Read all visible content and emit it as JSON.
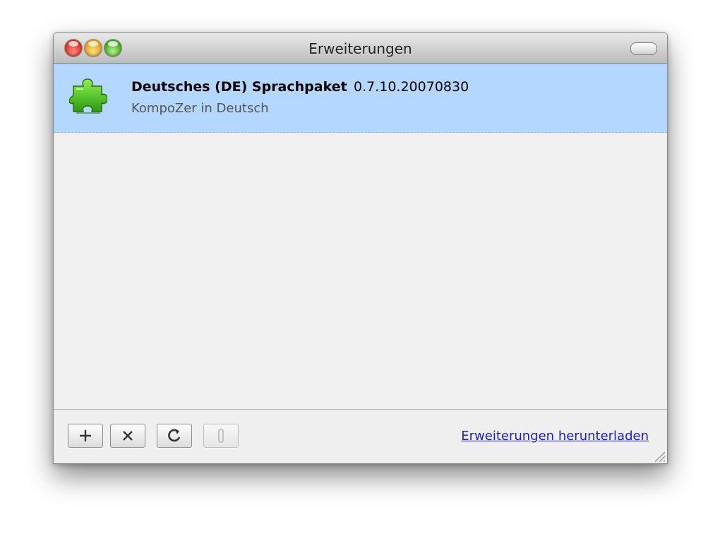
{
  "window": {
    "title": "Erweiterungen"
  },
  "extensions": [
    {
      "name": "Deutsches (DE) Sprachpaket",
      "version": "0.7.10.20070830",
      "description": "KompoZer in Deutsch",
      "icon": "puzzle-piece-icon",
      "selected": true
    }
  ],
  "toolbar": {
    "add_icon": "plus-icon",
    "remove_icon": "x-icon",
    "update_icon": "refresh-icon",
    "options_icon": "options-icon",
    "download_link": "Erweiterungen herunterladen"
  },
  "colors": {
    "selection": "#b3d7ff",
    "link": "#1a1aee",
    "icon_green": "#44b81f"
  }
}
